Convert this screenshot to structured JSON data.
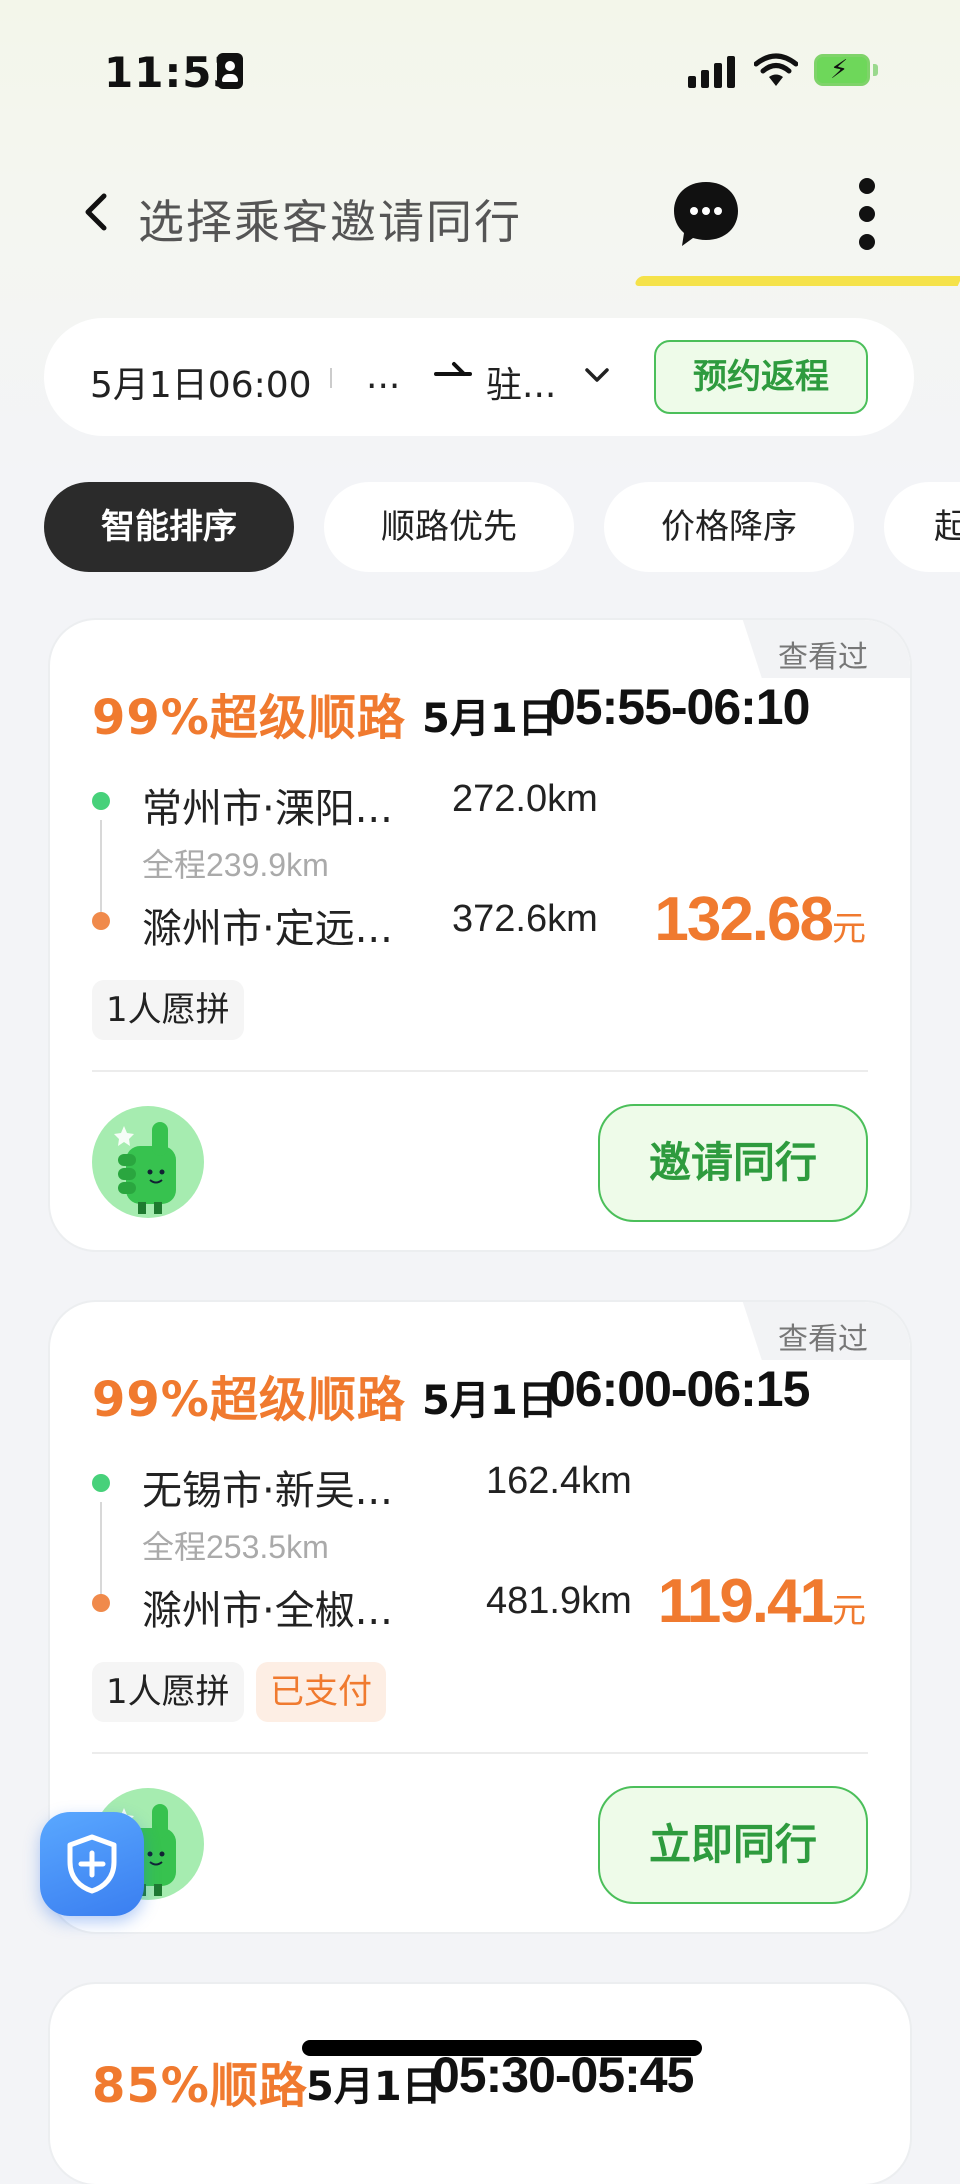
{
  "status_bar": {
    "time": "11:53"
  },
  "nav": {
    "title": "选择乘客邀请同行"
  },
  "filter": {
    "date_time": "5月1日06:00",
    "origin": "...",
    "destination": "驻...",
    "return_button": "预约返程"
  },
  "sort_tabs": [
    {
      "label": "智能排序",
      "active": true
    },
    {
      "label": "顺路优先",
      "active": false
    },
    {
      "label": "价格降序",
      "active": false
    },
    {
      "label": "起",
      "active": false
    }
  ],
  "orders": [
    {
      "viewed": "查看过",
      "match": "99%超级顺路",
      "date": "5月1日",
      "time": "05:55-06:10",
      "start_place": "常州市·溧阳...",
      "start_distance": "272.0km",
      "total_distance": "全程239.9km",
      "end_place": "滁州市·定远...",
      "end_distance": "372.6km",
      "price": "132.68",
      "price_unit": "元",
      "tags": [
        "1人愿拼"
      ],
      "action": "邀请同行"
    },
    {
      "viewed": "查看过",
      "match": "99%超级顺路",
      "date": "5月1日",
      "time": "06:00-06:15",
      "start_place": "无锡市·新吴...",
      "start_distance": "162.4km",
      "total_distance": "全程253.5km",
      "end_place": "滁州市·全椒...",
      "end_distance": "481.9km",
      "price": "119.41",
      "price_unit": "元",
      "tags": [
        "1人愿拼",
        "已支付"
      ],
      "action": "立即同行"
    },
    {
      "match": "85%顺路",
      "date": "5月1日",
      "time": "05:30-05:45"
    }
  ],
  "colors": {
    "accent_orange": "#f07a2f",
    "accent_green": "#2e9b3e",
    "nav_accent_yellow": "#f5e24a"
  },
  "icons": {
    "back": "back-arrow-icon",
    "chat": "chat-bubble-icon",
    "more": "more-vertical-icon",
    "safety": "shield-plus-icon"
  }
}
